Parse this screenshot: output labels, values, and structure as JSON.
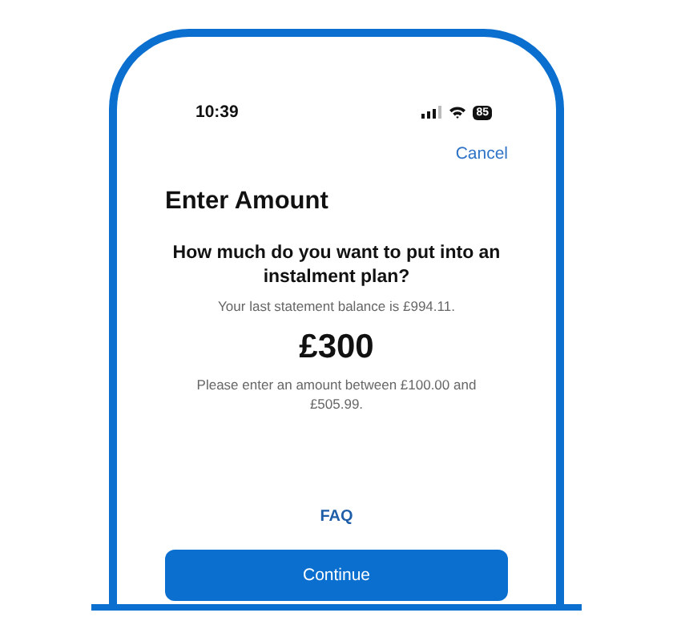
{
  "status_bar": {
    "time": "10:39",
    "battery": "85"
  },
  "nav": {
    "cancel": "Cancel"
  },
  "title": "Enter Amount",
  "question": "How much do you want to put into an instalment plan?",
  "balance_note": "Your last statement balance is £994.11.",
  "amount": "£300",
  "range_note": "Please enter an amount between £100.00 and £505.99.",
  "faq": "FAQ",
  "buttons": [
    "Continue"
  ]
}
